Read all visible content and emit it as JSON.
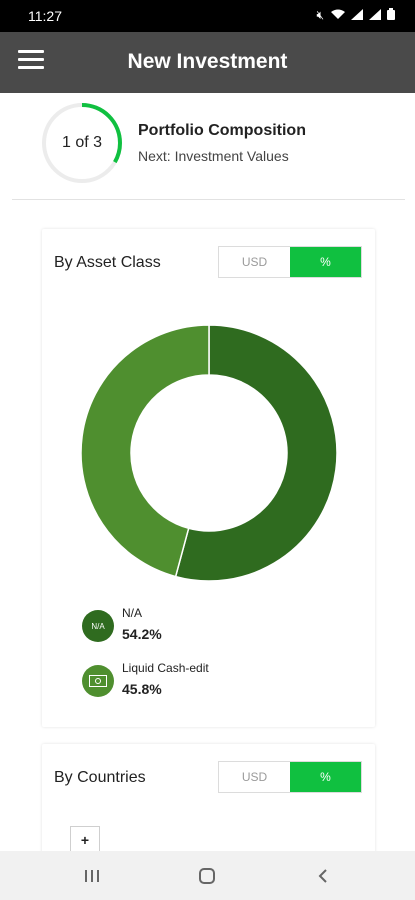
{
  "status": {
    "time": "11:27",
    "icons": [
      "mute-icon",
      "wifi-icon",
      "signal-icon",
      "signal-icon",
      "battery-icon"
    ]
  },
  "app_bar": {
    "title": "New Investment"
  },
  "progress": {
    "text": "1 of 3",
    "current": 1,
    "total": 3,
    "color": "#10c040"
  },
  "step": {
    "title": "Portfolio Composition",
    "next": "Next: Investment Values"
  },
  "asset_card": {
    "title": "By Asset Class",
    "toggle": {
      "usd": "USD",
      "pct": "%",
      "selected": "%"
    }
  },
  "countries_card": {
    "title": "By Countries",
    "toggle": {
      "usd": "USD",
      "pct": "%",
      "selected": "%"
    },
    "zoom_label": "+"
  },
  "legend": [
    {
      "icon_text": "N/A",
      "label": "N/A",
      "value": "54.2%",
      "color": "#2f6b1f"
    },
    {
      "icon_text": "cash",
      "label": "Liquid Cash-edit",
      "value": "45.8%",
      "color": "#4f8f2f"
    }
  ],
  "chart_data": {
    "type": "pie",
    "categories": [
      "N/A",
      "Liquid Cash-edit"
    ],
    "values": [
      54.2,
      45.8
    ],
    "colors": [
      "#2f6b1f",
      "#4f8f2f"
    ],
    "title": "By Asset Class"
  }
}
